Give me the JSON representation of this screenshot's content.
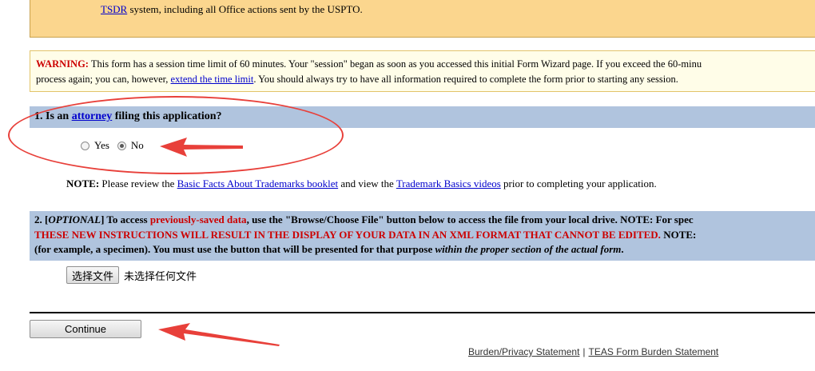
{
  "notice": {
    "link": "TSDR",
    "text": " system, including all Office actions sent by the USPTO."
  },
  "warning": {
    "label": "WARNING:",
    "line1": " This form has a session time limit of 60 minutes. Your \"session\" began as soon as you accessed this initial Form Wizard page. If you exceed the 60-minu",
    "line2_pre": "process again; you can, however, ",
    "line2_link": "extend the time limit",
    "line2_post": ". You should always try to have all information required to complete the form prior to starting any session."
  },
  "question1": {
    "prefix": "1. Is an ",
    "link": "attorney",
    "suffix": " filing this application?",
    "options": [
      {
        "label": "Yes",
        "checked": false
      },
      {
        "label": "No",
        "checked": true
      }
    ]
  },
  "note": {
    "label": "NOTE:",
    "pre": " Please review the ",
    "link1": "Basic Facts About Trademarks booklet",
    "mid": " and view the ",
    "link2": "Trademark Basics videos",
    "post": " prior to completing your application."
  },
  "question2": {
    "l1_pre": "2. [",
    "l1_optional": "OPTIONAL",
    "l1_mid": "] To access ",
    "l1_red": "previously-saved data",
    "l1_post": ", use the \"Browse/Choose File\" button below to access the file from your local drive. NOTE: For spec",
    "l2_red": "THESE NEW INSTRUCTIONS WILL RESULT IN THE DISPLAY OF YOUR DATA IN AN XML FORMAT THAT CANNOT BE EDITED.",
    "l2_post": " NOTE:",
    "l3_pre": "(for example, a specimen). You must use the button that will be presented for that purpose ",
    "l3_italic": "within the proper section of the actual form",
    "l3_post": "."
  },
  "file_input": {
    "button_label": "选择文件",
    "status": "未选择任何文件"
  },
  "continue_label": "Continue",
  "footer": {
    "link1": "Burden/Privacy Statement",
    "separator": "|",
    "link2": "TEAS Form Burden Statement"
  },
  "colors": {
    "annotation_red": "#e8403a",
    "question_bar": "#b0c4de",
    "notice_bg": "#fbd68e"
  }
}
